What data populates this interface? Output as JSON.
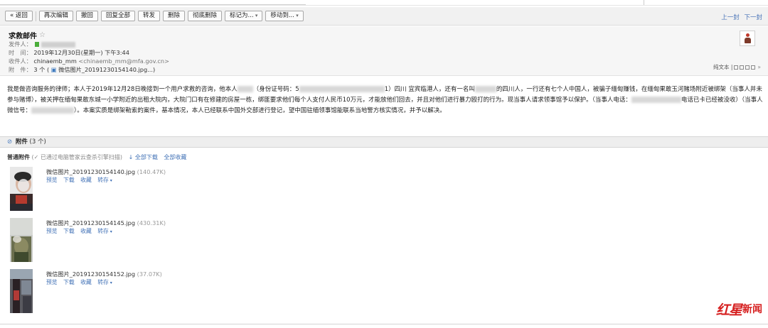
{
  "toolbar": {
    "buttons": [
      "« 返回",
      "再次编辑",
      "撤回",
      "回复全部",
      "转发",
      "删除",
      "彻底删除",
      "标记为...",
      "移动到..."
    ],
    "nav": {
      "prev": "上一封",
      "next": "下一封"
    }
  },
  "header": {
    "subject": "求救邮件",
    "star": "☆",
    "from_label": "发件人：",
    "time_label": "时　间：",
    "time_value": "2019年12月30日(星期一) 下午3:44",
    "to_label": "收件人：",
    "to_name": "chinaemb_mm",
    "to_addr": "<chinaemb_mm@mfa.gov.cn>",
    "attach_label": "附　件：",
    "attach_value": "3 个 (",
    "attach_file": "微信图片_20191230154140.jpg...)",
    "plain_text": "纯文本 |"
  },
  "body": {
    "p1": "我是做咨询服务的律师；本人于2019年12月28日晚接到一个用户求救的咨询，他本人",
    "p2": "（身份证号码：5",
    "p3": "1）四川 宜宾临港人，还有一名叫",
    "p4": "的四川人，一行还有七个人中国人，被骗子缅甸赚钱，在缅甸果敢玉河赌场附近被绑架（当事人并未参与赌博），被关押在缅甸果敢东城一小学附近的出租大院内，大院门口有在修建的房屋一栋，绑匪要求他们每个人支付人民币10万元，才能放他们回去，并且对他们进行暴力殴打的行为。现当事人请求领事馆予以保护。（当事人电话：",
    "p5": "电话已卡已经被没收）（当事人微信号：",
    "p6": "）。本案实质是绑架勒索的案件，基本情况，本人已经联系中国外交部进行登记，望中国驻缅领事馆能联系当地警方核实情况，并予以解决。"
  },
  "attachments": {
    "header_label": "附件",
    "header_count": "(3 个)",
    "sub_label": "普通附件",
    "sub_note": "(✓ 已通过电脑管家云查杀引擎扫描)",
    "download_all": "↓ 全部下载",
    "save_all": "全部收藏",
    "items": [
      {
        "name": "微信图片_20191230154140.jpg",
        "size": "(140.47K)",
        "actions": [
          "预览",
          "下载",
          "收藏",
          "转存"
        ]
      },
      {
        "name": "微信图片_20191230154145.jpg",
        "size": "(430.31K)",
        "actions": [
          "预览",
          "下载",
          "收藏",
          "转存"
        ]
      },
      {
        "name": "微信图片_20191230154152.jpg",
        "size": "(37.07K)",
        "actions": [
          "预览",
          "下载",
          "收藏",
          "转存"
        ]
      }
    ]
  },
  "watermark": {
    "part1": "红星",
    "part2": "新闻"
  },
  "colors": {
    "link": "#3e6fb5",
    "watermark": "#d62020",
    "toolbar_bg": "#f1f1f1"
  }
}
